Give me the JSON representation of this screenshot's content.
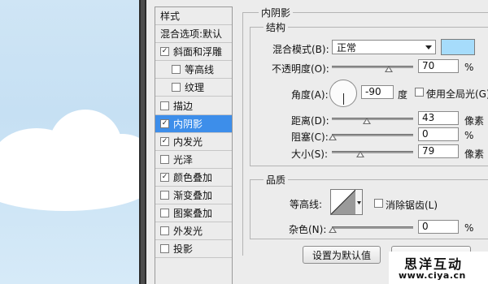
{
  "styles_list": {
    "header": "样式",
    "blend_options": "混合选项:默认",
    "items": [
      {
        "label": "斜面和浮雕",
        "checked": true,
        "sub": false,
        "selected": false
      },
      {
        "label": "等高线",
        "checked": false,
        "sub": true,
        "selected": false
      },
      {
        "label": "纹理",
        "checked": false,
        "sub": true,
        "selected": false
      },
      {
        "label": "描边",
        "checked": false,
        "sub": false,
        "selected": false
      },
      {
        "label": "内阴影",
        "checked": true,
        "sub": false,
        "selected": true
      },
      {
        "label": "内发光",
        "checked": true,
        "sub": false,
        "selected": false
      },
      {
        "label": "光泽",
        "checked": false,
        "sub": false,
        "selected": false
      },
      {
        "label": "颜色叠加",
        "checked": true,
        "sub": false,
        "selected": false
      },
      {
        "label": "渐变叠加",
        "checked": false,
        "sub": false,
        "selected": false
      },
      {
        "label": "图案叠加",
        "checked": false,
        "sub": false,
        "selected": false
      },
      {
        "label": "外发光",
        "checked": false,
        "sub": false,
        "selected": false
      },
      {
        "label": "投影",
        "checked": false,
        "sub": false,
        "selected": false
      }
    ]
  },
  "inner_shadow": {
    "title": "内阴影",
    "structure": {
      "title": "结构",
      "blend_mode_label": "混合模式(B):",
      "blend_mode_value": "正常",
      "shadow_color": "#a6dcfb",
      "opacity_label": "不透明度(O):",
      "opacity_value": "70",
      "opacity_unit": "%",
      "angle_label": "角度(A):",
      "angle_value": "-90",
      "angle_unit": "度",
      "global_light_label": "使用全局光(G)",
      "global_light_checked": false,
      "distance_label": "距离(D):",
      "distance_value": "43",
      "distance_unit": "像素",
      "choke_label": "阻塞(C):",
      "choke_value": "0",
      "choke_unit": "%",
      "size_label": "大小(S):",
      "size_value": "79",
      "size_unit": "像素"
    },
    "quality": {
      "title": "品质",
      "contour_label": "等高线:",
      "anti_alias_label": "消除锯齿(L)",
      "anti_alias_checked": false,
      "noise_label": "杂色(N):",
      "noise_value": "0",
      "noise_unit": "%"
    },
    "buttons": {
      "set_default": "设置为默认值"
    }
  },
  "watermark": {
    "title": "思洋互动",
    "url": "www.ciya.cn"
  }
}
